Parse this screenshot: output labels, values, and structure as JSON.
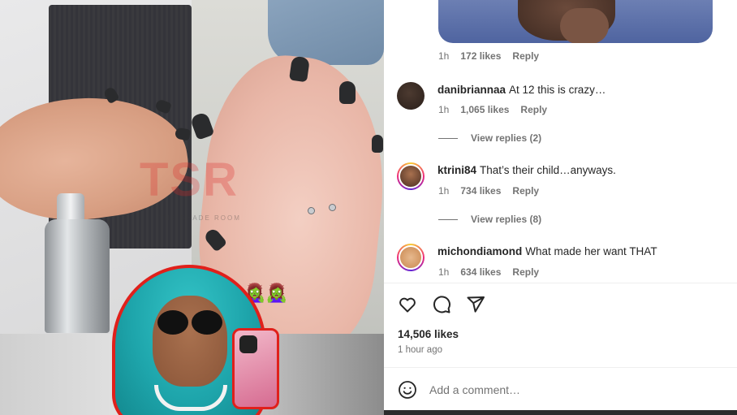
{
  "media": {
    "watermark": "TSR",
    "watermark_sub": "THE SHADE ROOM",
    "sticker": "🧟‍♀️🧟‍♀️"
  },
  "comments": [
    {
      "username": "",
      "text": "",
      "time": "1h",
      "likes": "172 likes",
      "reply": "Reply"
    },
    {
      "username": "danibriannaa",
      "text": "At 12 this is crazy…",
      "time": "1h",
      "likes": "1,065 likes",
      "reply": "Reply",
      "view_replies": "View replies (2)"
    },
    {
      "username": "ktrini84",
      "text": "That’s their child…anyways.",
      "time": "1h",
      "likes": "734 likes",
      "reply": "Reply",
      "view_replies": "View replies (8)"
    },
    {
      "username": "michondiamond",
      "text": "What made her want THAT",
      "time": "1h",
      "likes": "634 likes",
      "reply": "Reply"
    }
  ],
  "actions": {
    "like_icon": "heart-icon",
    "comment_icon": "comment-icon",
    "share_icon": "send-icon"
  },
  "post": {
    "likes": "14,506 likes",
    "time_ago": "1 hour ago"
  },
  "add_comment": {
    "placeholder": "Add a comment…",
    "emoji_icon": "smiley-icon"
  }
}
